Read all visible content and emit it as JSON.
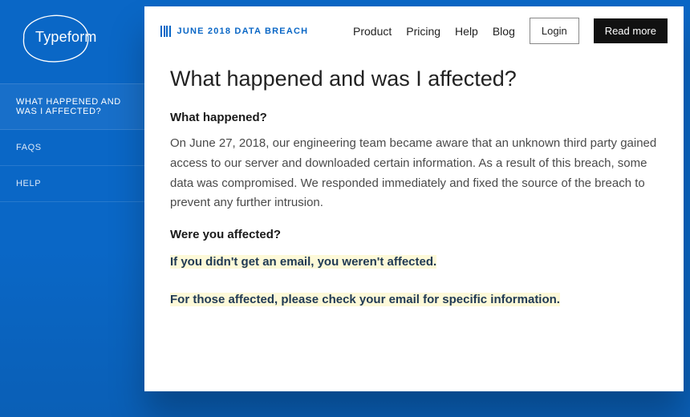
{
  "brand": {
    "name": "Typeform"
  },
  "sidebar": {
    "items": [
      {
        "label": "WHAT HAPPENED AND WAS I AFFECTED?"
      },
      {
        "label": "FAQS"
      },
      {
        "label": "HELP"
      }
    ]
  },
  "header": {
    "breadcrumb": "JUNE 2018 DATA BREACH",
    "nav": [
      {
        "label": "Product"
      },
      {
        "label": "Pricing"
      },
      {
        "label": "Help"
      },
      {
        "label": "Blog"
      }
    ],
    "login": "Login",
    "readmore": "Read more"
  },
  "article": {
    "title": "What happened and was I affected?",
    "section1_heading": "What happened?",
    "section1_body": "On June 27, 2018, our engineering team became aware that an unknown third party gained access to our server and downloaded certain information. As a result of this breach, some data was compromised. We responded immediately and fixed the source of the breach to prevent any further intrusion.",
    "section2_heading": "Were you affected?",
    "highlight1": "If you didn't get an email, you weren't affected.",
    "highlight2": "For those affected, please check your email for specific information."
  },
  "colors": {
    "primary": "#0a67c6",
    "highlight_bg": "#fdf9d8",
    "dark": "#111111"
  }
}
